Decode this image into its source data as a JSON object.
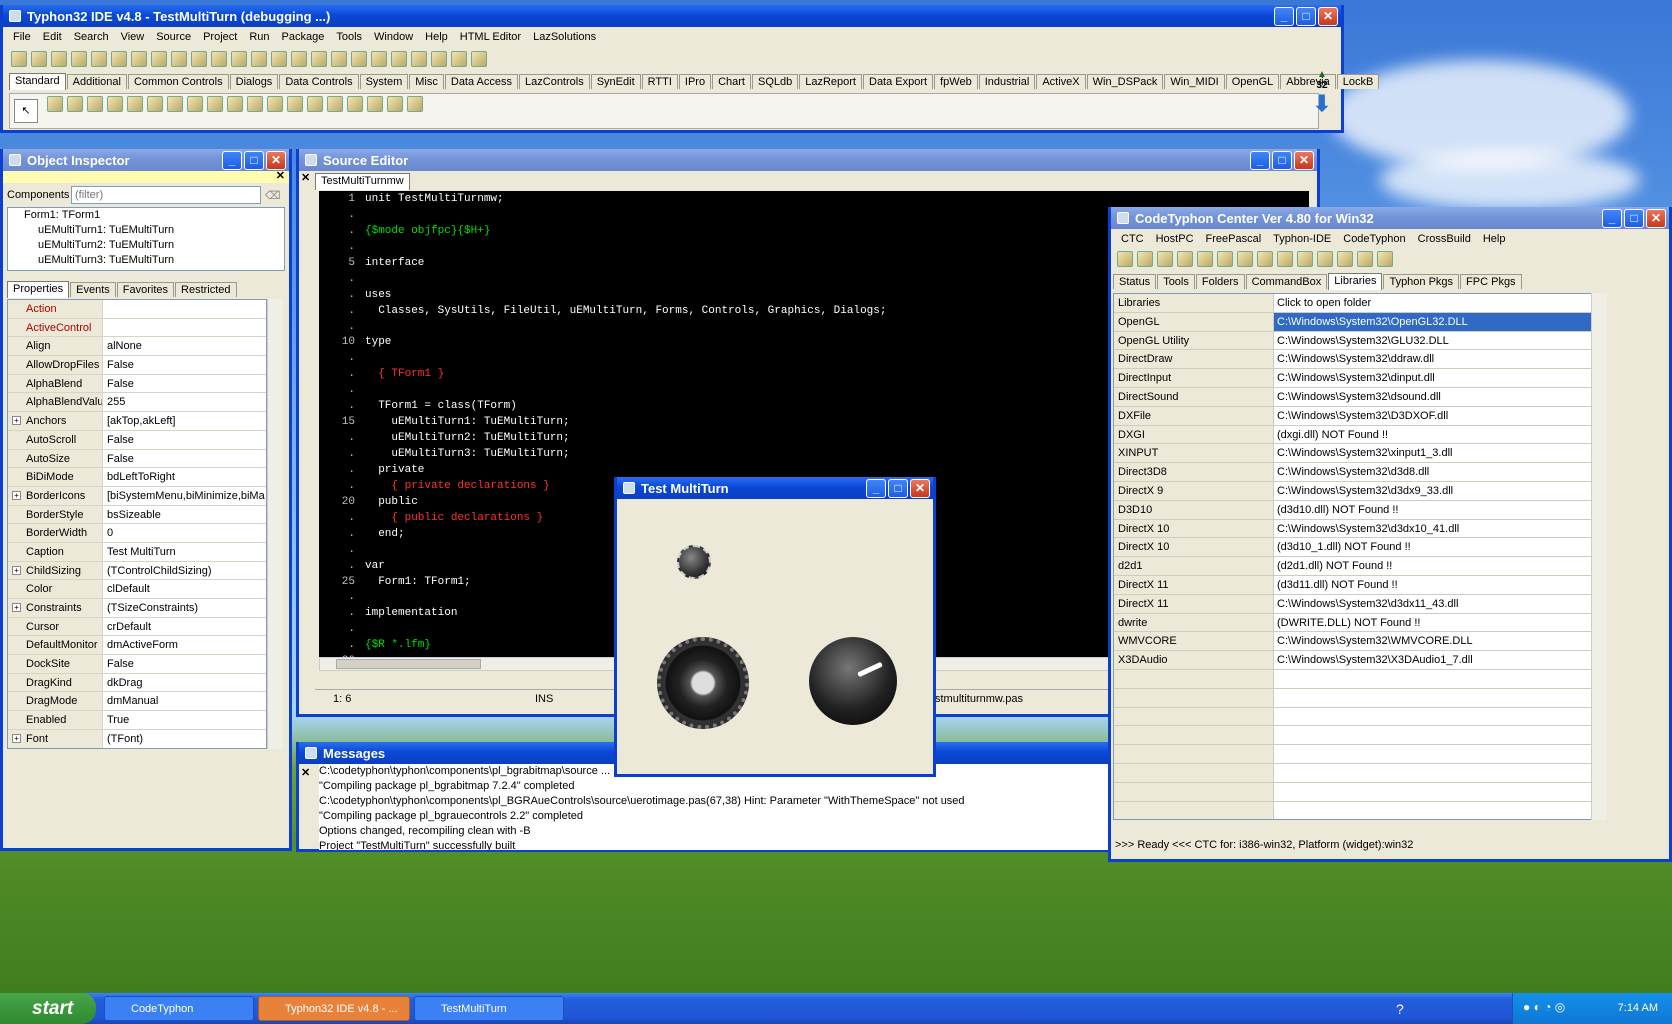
{
  "ide": {
    "title": "Typhon32 IDE v4.8 - TestMultiTurn (debugging ...)",
    "menu": [
      "File",
      "Edit",
      "Search",
      "View",
      "Source",
      "Project",
      "Run",
      "Package",
      "Tools",
      "Window",
      "Help",
      "HTML Editor",
      "LazSolutions"
    ],
    "palette_tabs": [
      "Standard",
      "Additional",
      "Common Controls",
      "Dialogs",
      "Data Controls",
      "System",
      "Misc",
      "Data Access",
      "LazControls",
      "SynEdit",
      "RTTI",
      "IPro",
      "Chart",
      "SQLdb",
      "LazReport",
      "Data Export",
      "fpWeb",
      "Industrial",
      "ActiveX",
      "Win_DSPack",
      "Win_MIDI",
      "OpenGL",
      "Abbrevia",
      "LockB"
    ],
    "palette_count": "32"
  },
  "inspector": {
    "title": "Object Inspector",
    "components_label": "Components",
    "filter_placeholder": "(filter)",
    "tree": [
      "Form1: TForm1",
      "uEMultiTurn1: TuEMultiTurn",
      "uEMultiTurn2: TuEMultiTurn",
      "uEMultiTurn3: TuEMultiTurn"
    ],
    "tabs": [
      "Properties",
      "Events",
      "Favorites",
      "Restricted"
    ],
    "props": [
      {
        "name": "Action",
        "value": "",
        "red": true
      },
      {
        "name": "ActiveControl",
        "value": "",
        "red": true
      },
      {
        "name": "Align",
        "value": "alNone"
      },
      {
        "name": "AllowDropFiles",
        "value": "False"
      },
      {
        "name": "AlphaBlend",
        "value": "False"
      },
      {
        "name": "AlphaBlendValue",
        "value": "255"
      },
      {
        "name": "Anchors",
        "value": "[akTop,akLeft]",
        "plus": true
      },
      {
        "name": "AutoScroll",
        "value": "False"
      },
      {
        "name": "AutoSize",
        "value": "False"
      },
      {
        "name": "BiDiMode",
        "value": "bdLeftToRight"
      },
      {
        "name": "BorderIcons",
        "value": "[biSystemMenu,biMinimize,biMa",
        "plus": true
      },
      {
        "name": "BorderStyle",
        "value": "bsSizeable"
      },
      {
        "name": "BorderWidth",
        "value": "0"
      },
      {
        "name": "Caption",
        "value": "Test MultiTurn"
      },
      {
        "name": "ChildSizing",
        "value": "(TControlChildSizing)",
        "plus": true
      },
      {
        "name": "Color",
        "value": "clDefault"
      },
      {
        "name": "Constraints",
        "value": "(TSizeConstraints)",
        "plus": true
      },
      {
        "name": "Cursor",
        "value": "crDefault"
      },
      {
        "name": "DefaultMonitor",
        "value": "dmActiveForm"
      },
      {
        "name": "DockSite",
        "value": "False"
      },
      {
        "name": "DragKind",
        "value": "dkDrag"
      },
      {
        "name": "DragMode",
        "value": "dmManual"
      },
      {
        "name": "Enabled",
        "value": "True"
      },
      {
        "name": "Font",
        "value": "(TFont)",
        "plus": true
      }
    ]
  },
  "editor": {
    "title": "Source Editor",
    "tab": "TestMultiTurnmw",
    "lines": [
      {
        "n": "1",
        "t": "unit TestMultiTurnmw;",
        "c": "#ffffff"
      },
      {
        "n": ".",
        "t": "",
        "c": "#fff"
      },
      {
        "n": ".",
        "t": "{$mode objfpc}{$H+}",
        "c": "#00e000"
      },
      {
        "n": ".",
        "t": "",
        "c": "#fff"
      },
      {
        "n": "5",
        "t": "interface",
        "c": "#ffffff"
      },
      {
        "n": ".",
        "t": "",
        "c": "#fff"
      },
      {
        "n": ".",
        "t": "uses",
        "c": "#ffffff"
      },
      {
        "n": ".",
        "t": "  Classes, SysUtils, FileUtil, uEMultiTurn, Forms, Controls, Graphics, Dialogs;",
        "c": "#ffffff"
      },
      {
        "n": ".",
        "t": "",
        "c": "#fff"
      },
      {
        "n": "10",
        "t": "type",
        "c": "#ffffff"
      },
      {
        "n": ".",
        "t": "",
        "c": "#fff"
      },
      {
        "n": ".",
        "t": "  { TForm1 }",
        "c": "#ff3030"
      },
      {
        "n": ".",
        "t": "",
        "c": "#fff"
      },
      {
        "n": ".",
        "t": "  TForm1 = class(TForm)",
        "c": "#ffffff"
      },
      {
        "n": "15",
        "t": "    uEMultiTurn1: TuEMultiTurn;",
        "c": "#ffffff"
      },
      {
        "n": ".",
        "t": "    uEMultiTurn2: TuEMultiTurn;",
        "c": "#ffffff"
      },
      {
        "n": ".",
        "t": "    uEMultiTurn3: TuEMultiTurn;",
        "c": "#ffffff"
      },
      {
        "n": ".",
        "t": "  private",
        "c": "#ffffff"
      },
      {
        "n": ".",
        "t": "    { private declarations }",
        "c": "#ff3030"
      },
      {
        "n": "20",
        "t": "  public",
        "c": "#ffffff"
      },
      {
        "n": ".",
        "t": "    { public declarations }",
        "c": "#ff3030"
      },
      {
        "n": ".",
        "t": "  end;",
        "c": "#ffffff"
      },
      {
        "n": ".",
        "t": "",
        "c": "#fff"
      },
      {
        "n": ".",
        "t": "var",
        "c": "#ffffff"
      },
      {
        "n": "25",
        "t": "  Form1: TForm1;",
        "c": "#ffffff"
      },
      {
        "n": ".",
        "t": "",
        "c": "#fff"
      },
      {
        "n": ".",
        "t": "implementation",
        "c": "#ffffff"
      },
      {
        "n": ".",
        "t": "",
        "c": "#fff"
      },
      {
        "n": ".",
        "t": "{$R *.lfm}",
        "c": "#00e000"
      },
      {
        "n": "30",
        "t": "",
        "c": "#fff"
      }
    ],
    "status_pos": "1: 6",
    "status_mode": "INS",
    "status_file": "stmultiturnmw.pas"
  },
  "messages": {
    "title": "Messages",
    "lines": [
      "C:\\codetyphon\\typhon\\components\\pl_bgrabitmap\\source ... Hint: ... memory",
      "\"Compiling package pl_bgrabitmap 7.2.4\" completed",
      "C:\\codetyphon\\typhon\\components\\pl_BGRAueControls\\source\\uerotimage.pas(67,38) Hint: Parameter \"WithThemeSpace\" not used",
      "\"Compiling package pl_bgrauecontrols 2.2\" completed",
      "Options changed, recompiling clean with -B",
      "Project \"TestMultiTurn\" successfully built"
    ]
  },
  "testform": {
    "title": "Test MultiTurn"
  },
  "ctc": {
    "title": "CodeTyphon Center Ver 4.80 for Win32",
    "menu": [
      "CTC",
      "HostPC",
      "FreePascal",
      "Typhon-IDE",
      "CodeTyphon",
      "CrossBuild",
      "Help"
    ],
    "tabs": [
      "Status",
      "Tools",
      "Folders",
      "CommandBox",
      "Libraries",
      "Typhon Pkgs",
      "FPC Pkgs"
    ],
    "col1": "Libraries",
    "col2": "Click to open folder",
    "rows": [
      {
        "lib": "OpenGL",
        "path": "C:\\Windows\\System32\\OpenGL32.DLL"
      },
      {
        "lib": "OpenGL Utility",
        "path": "C:\\Windows\\System32\\GLU32.DLL"
      },
      {
        "lib": "DirectDraw",
        "path": "C:\\Windows\\System32\\ddraw.dll"
      },
      {
        "lib": "DirectInput",
        "path": "C:\\Windows\\System32\\dinput.dll"
      },
      {
        "lib": "DirectSound",
        "path": "C:\\Windows\\System32\\dsound.dll"
      },
      {
        "lib": "DXFile",
        "path": "C:\\Windows\\System32\\D3DXOF.dll"
      },
      {
        "lib": "DXGI",
        "path": "(dxgi.dll) NOT Found !!"
      },
      {
        "lib": "XINPUT",
        "path": "C:\\Windows\\System32\\xinput1_3.dll"
      },
      {
        "lib": "Direct3D8",
        "path": "C:\\Windows\\System32\\d3d8.dll"
      },
      {
        "lib": "DirectX 9",
        "path": "C:\\Windows\\System32\\d3dx9_33.dll"
      },
      {
        "lib": "D3D10",
        "path": "(d3d10.dll) NOT Found !!"
      },
      {
        "lib": "DirectX 10",
        "path": "C:\\Windows\\System32\\d3dx10_41.dll"
      },
      {
        "lib": "DirectX 10",
        "path": "(d3d10_1.dll) NOT Found !!"
      },
      {
        "lib": "d2d1",
        "path": "(d2d1.dll) NOT Found !!"
      },
      {
        "lib": "DirectX 11",
        "path": "(d3d11.dll) NOT Found !!"
      },
      {
        "lib": "DirectX 11",
        "path": "C:\\Windows\\System32\\d3dx11_43.dll"
      },
      {
        "lib": "dwrite",
        "path": "(DWRITE.DLL) NOT Found !!"
      },
      {
        "lib": "WMVCORE",
        "path": "C:\\Windows\\System32\\WMVCORE.DLL"
      },
      {
        "lib": "X3DAudio",
        "path": "C:\\Windows\\System32\\X3DAudio1_7.dll"
      }
    ],
    "status": ">>> Ready <<<  CTC for: i386-win32, Platform (widget):win32"
  },
  "taskbar": {
    "start": "start",
    "tasks": [
      "CodeTyphon",
      "Typhon32 IDE v4.8 - ...",
      "TestMultiTurn"
    ],
    "clock": "7:14 AM"
  }
}
